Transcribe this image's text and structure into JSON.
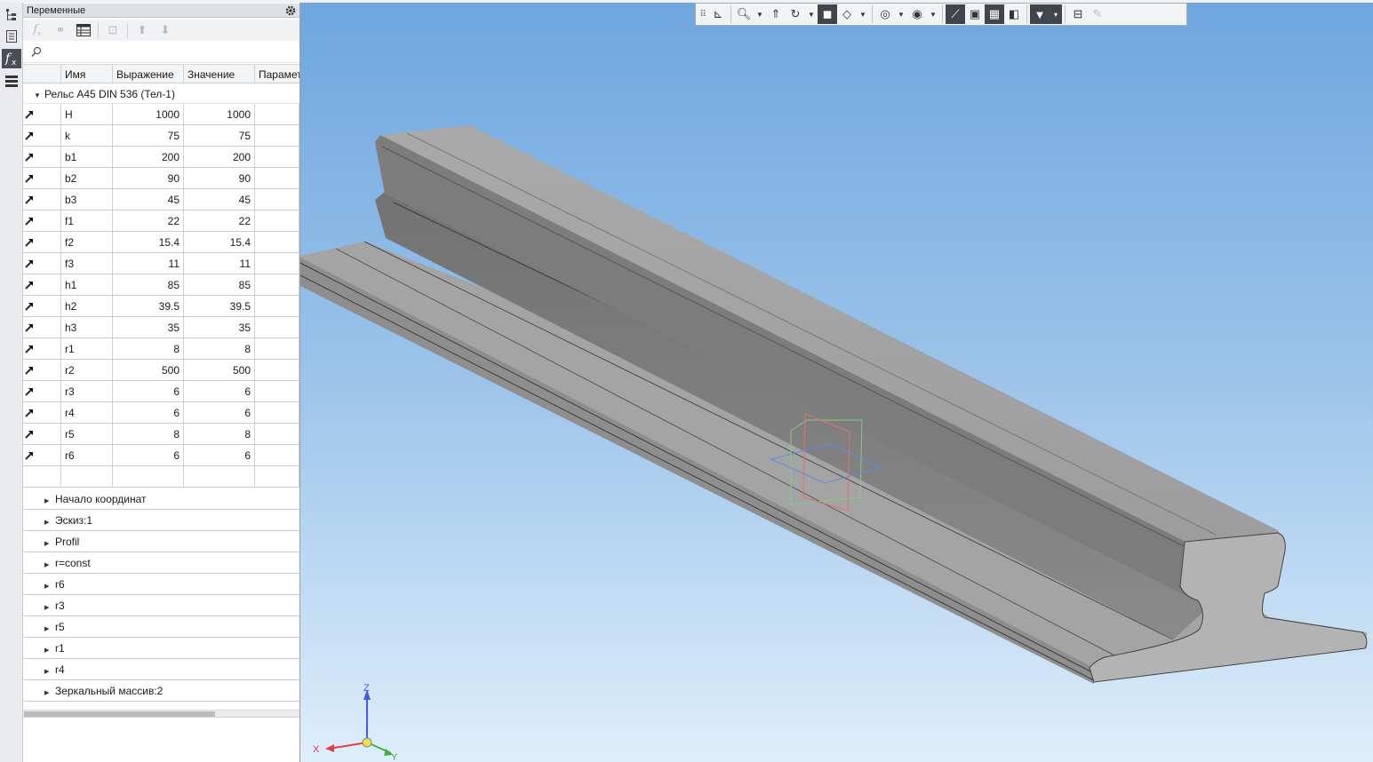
{
  "left_strip": {
    "icons": [
      "tree-icon",
      "properties-icon",
      "fx-variables-icon",
      "layers-icon"
    ]
  },
  "panel": {
    "title": "Переменные",
    "search_placeholder": "",
    "columns": [
      "Имя",
      "Выражение",
      "Значение",
      "Парамет"
    ],
    "group_label": "Рельс A45 DIN 536 (Тел-1)",
    "variables": [
      {
        "name": "H",
        "expression": "1000",
        "value": "1000"
      },
      {
        "name": "k",
        "expression": "75",
        "value": "75"
      },
      {
        "name": "b1",
        "expression": "200",
        "value": "200"
      },
      {
        "name": "b2",
        "expression": "90",
        "value": "90"
      },
      {
        "name": "b3",
        "expression": "45",
        "value": "45"
      },
      {
        "name": "f1",
        "expression": "22",
        "value": "22"
      },
      {
        "name": "f2",
        "expression": "15.4",
        "value": "15.4"
      },
      {
        "name": "f3",
        "expression": "11",
        "value": "11"
      },
      {
        "name": "h1",
        "expression": "85",
        "value": "85"
      },
      {
        "name": "h2",
        "expression": "39.5",
        "value": "39.5"
      },
      {
        "name": "h3",
        "expression": "35",
        "value": "35"
      },
      {
        "name": "r1",
        "expression": "8",
        "value": "8"
      },
      {
        "name": "r2",
        "expression": "500",
        "value": "500"
      },
      {
        "name": "r3",
        "expression": "6",
        "value": "6"
      },
      {
        "name": "r4",
        "expression": "6",
        "value": "6"
      },
      {
        "name": "r5",
        "expression": "8",
        "value": "8"
      },
      {
        "name": "r6",
        "expression": "6",
        "value": "6"
      }
    ],
    "tree_items": [
      "Начало координат",
      "Эскиз:1",
      "Profil",
      "r=const",
      "r6",
      "r3",
      "r5",
      "r1",
      "r4",
      "Зеркальный массив:2"
    ]
  },
  "triad": {
    "x": "X",
    "y": "Y",
    "z": "Z"
  },
  "colors": {
    "viewport_top": "#6ea6de",
    "viewport_bottom": "#dfeefb",
    "model_gray": "#9c9c9c",
    "x_axis": "#e04040",
    "y_axis": "#40b040",
    "z_axis": "#4060e0"
  }
}
